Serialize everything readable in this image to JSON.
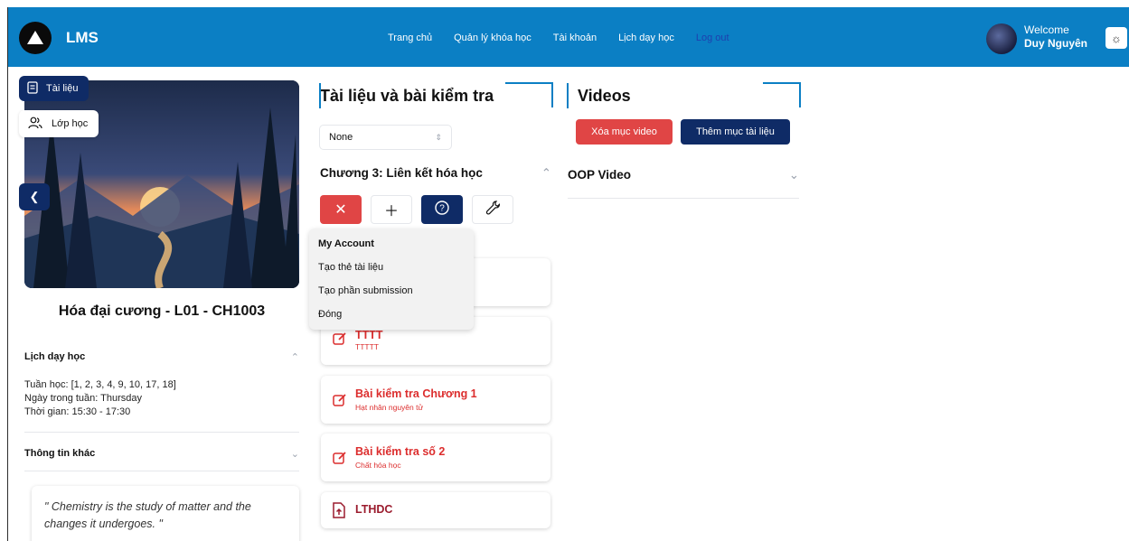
{
  "app": {
    "name": "LMS"
  },
  "nav": {
    "links": [
      "Trang chủ",
      "Quản lý khóa học",
      "Tài khoản",
      "Lịch dạy học"
    ],
    "logout": "Log out"
  },
  "user": {
    "welcome": "Welcome",
    "name": "Duy Nguyên"
  },
  "sidebar": {
    "pill_tailieu": "Tài liệu",
    "pill_lophoc": "Lớp học",
    "course_title": "Hóa đại cương - L01 - CH1003",
    "schedule": {
      "heading": "Lịch dạy học",
      "weeks": "Tuần học: [1, 2, 3, 4, 9, 10, 17, 18]",
      "day": "Ngày trong tuần: Thursday",
      "time": "Thời gian: 15:30 - 17:30"
    },
    "other_heading": "Thông tin khác",
    "quote": "\" Chemistry is the study of matter and the changes it undergoes. \""
  },
  "documents": {
    "title": "Tài liệu và bài kiểm tra",
    "select_value": "None",
    "chapter_title": "Chương 3: Liên kết hóa học",
    "menu": {
      "header": "My Account",
      "items": [
        "Tạo thẻ tài liệu",
        "Tạo phần submission",
        "Đóng"
      ]
    },
    "cards": [
      {
        "title": "TTTT",
        "subtitle": "TTTTT"
      },
      {
        "title": "Bài kiểm tra Chương 1",
        "subtitle": "Hạt nhân nguyên tử"
      },
      {
        "title": "Bài kiểm tra số 2",
        "subtitle": "Chất hóa học"
      },
      {
        "title": "LTHDC",
        "subtitle": ""
      }
    ]
  },
  "videos": {
    "title": "Videos",
    "delete_button": "Xóa mục video",
    "add_button": "Thêm mục tài liệu",
    "item": "OOP Video"
  },
  "colors": {
    "nav": "#0b7fc4",
    "navy": "#0f2b66",
    "red": "#e04545",
    "accent_red": "#dc2d2d"
  }
}
